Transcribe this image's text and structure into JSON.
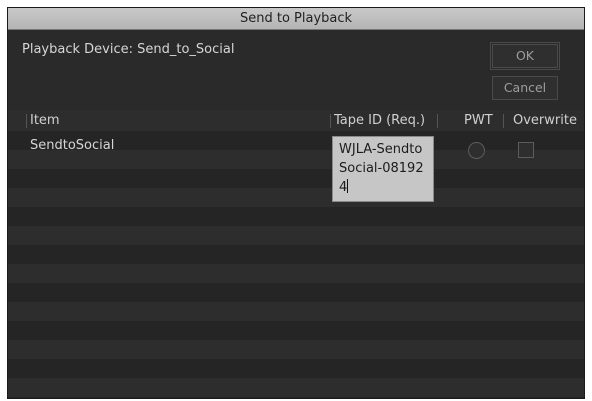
{
  "dialog": {
    "title": "Send to Playback",
    "device_label": "Playback Device: Send_to_Social",
    "ok_label": "OK",
    "cancel_label": "Cancel"
  },
  "table": {
    "columns": [
      "Item",
      "Tape ID (Req.)",
      "PWT",
      "Overwrite"
    ],
    "rows": [
      {
        "item": "SendtoSocial",
        "tape_id": "WJLA-SendtoSocial-081924",
        "pwt": false,
        "overwrite": false
      }
    ]
  }
}
